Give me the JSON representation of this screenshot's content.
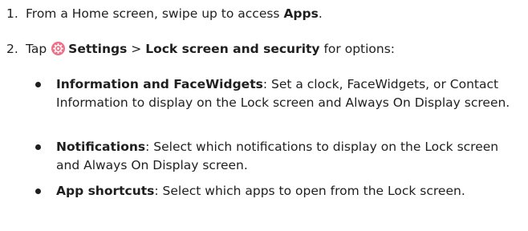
{
  "steps": [
    {
      "number": "1.",
      "text_before": "From a Home screen, swipe up to access ",
      "bold": "Apps",
      "text_after": "."
    },
    {
      "number": "2.",
      "text_tap": "Tap ",
      "icon": "settings-gear-icon",
      "settings_label": "Settings",
      "separator": " > ",
      "lock_label": "Lock screen and security",
      "text_after": " for options:"
    }
  ],
  "bullets": [
    {
      "title": "Information and FaceWidgets",
      "description": ": Set a clock, FaceWidgets, or Contact Information to display on the Lock screen and Always On Display screen."
    },
    {
      "title": "Notifications",
      "description": ": Select which notifications to display on the Lock screen and Always On Display screen."
    },
    {
      "title": "App shortcuts",
      "description": ": Select which apps to open from the Lock screen."
    }
  ],
  "colors": {
    "text": "#1f1f1f",
    "icon_bg": "#ee6f87",
    "icon_fg": "#ffffff"
  }
}
